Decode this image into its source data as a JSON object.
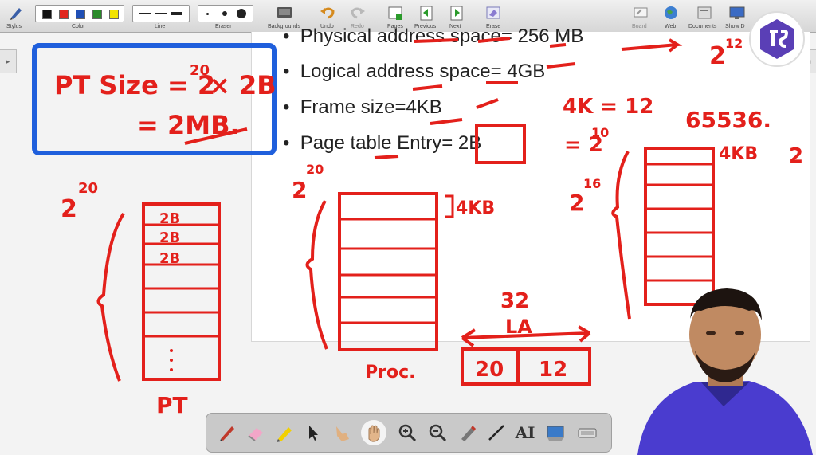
{
  "toolbar": {
    "labels": {
      "stylus": "Stylus",
      "color": "Color",
      "line": "Line",
      "eraser": "Eraser",
      "backgrounds": "Backgrounds",
      "undo": "Undo",
      "redo": "Redo",
      "pages": "Pages",
      "previous": "Previous",
      "next": "Next",
      "erase": "Erase",
      "board": "Board",
      "web": "Web",
      "documents": "Documents",
      "show_desktop": "Show D"
    },
    "colors": [
      "#111111",
      "#e0261e",
      "#1f4fb5",
      "#2a8a2a",
      "#f2e300"
    ]
  },
  "slide": {
    "bullets": [
      "Physical address space= 256 MB",
      "Logical address space= 4GB",
      "Frame size=4KB",
      "Page table Entry= 2B"
    ]
  },
  "annotations": {
    "pt_size_line1": "PT Size = 2",
    "pt_size_exp": "20",
    "pt_size_tail": "× 2B",
    "pt_size_line2": "= 2MB.",
    "top_right_2": "2",
    "top_right_exp": "12",
    "k4_eq_12": "4K = 12",
    "k_eq_2_10": "= 2",
    "k_eq_2_10_exp": "10",
    "n65536": "65536.",
    "left_2": "2",
    "left_exp": "20",
    "pt_entries": [
      "2B",
      "2B",
      "2B"
    ],
    "pt_label": "PT",
    "mid_2": "2",
    "mid_exp": "20",
    "mid_4kb": "4KB",
    "mid_label": "Proc.",
    "right_2": "2",
    "right_exp": "16",
    "right_4kb": "4KB",
    "edge_2": "2",
    "la_32": "32",
    "la_label": "LA",
    "la_fields": [
      "20",
      "12"
    ]
  },
  "bottom_tools": [
    "pen-icon",
    "eraser-icon",
    "highlighter-icon",
    "pointer-icon",
    "hand-pointer-icon",
    "pan-hand-icon",
    "zoom-in-icon",
    "zoom-out-icon",
    "marker-icon",
    "line-icon",
    "text-icon",
    "screen-capture-icon",
    "keyboard-icon"
  ]
}
